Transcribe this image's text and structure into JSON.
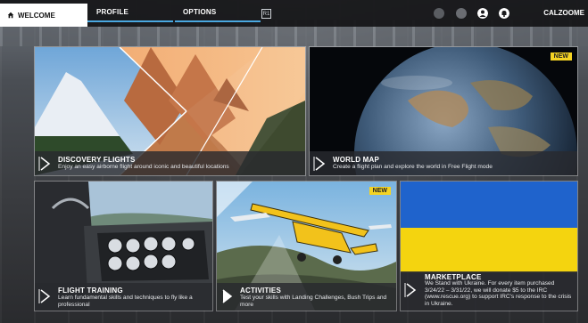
{
  "nav": {
    "welcome_label": "WELCOME",
    "profile_label": "PROFILE",
    "options_label": "OPTIONS",
    "username": "CALZOOME",
    "accent": "#4aa8e0"
  },
  "icons": {
    "home": "home-icon",
    "key_hint": "keyboard-key-icon",
    "status_a": "online-status-icon",
    "status_b": "friends-icon",
    "profile": "user-icon",
    "notifications": "notification-icon",
    "caption_arrow": "chevron-right-icon"
  },
  "cards": {
    "discovery": {
      "title": "DISCOVERY FLIGHTS",
      "desc": "Enjoy an easy airborne flight around iconic and beautiful locations"
    },
    "world_map": {
      "title": "WORLD MAP",
      "desc": "Create a flight plan and explore the world in Free Flight mode",
      "badge": "NEW"
    },
    "training": {
      "title": "FLIGHT TRAINING",
      "desc": "Learn fundamental skills and techniques to fly like a professional"
    },
    "activities": {
      "title": "ACTIVITIES",
      "desc": "Test your skills with Landing Challenges, Bush Trips and more",
      "badge": "NEW"
    },
    "marketplace": {
      "title": "MARKETPLACE",
      "desc": "We Stand with Ukraine. For every item purchased 3/24/22 – 3/31/22, we will donate $5 to the IRC (www.rescue.org) to support IRC's response to the crisis in Ukraine."
    }
  },
  "colors": {
    "badge": "#f5d323",
    "ukraine_blue": "#1f63cc",
    "ukraine_yellow": "#f4d40f"
  }
}
